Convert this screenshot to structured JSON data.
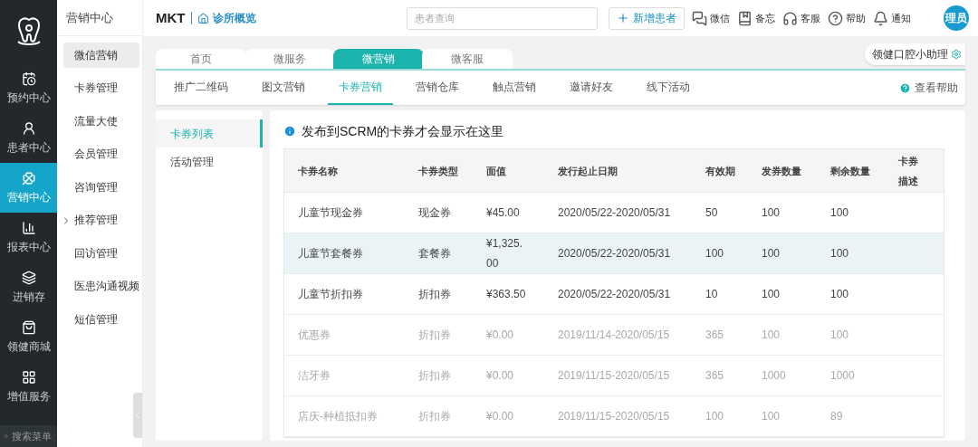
{
  "rail": {
    "items": [
      {
        "label": "预约中心",
        "selected": false
      },
      {
        "label": "患者中心",
        "selected": false
      },
      {
        "label": "营销中心",
        "selected": true
      },
      {
        "label": "报表中心",
        "selected": false
      },
      {
        "label": "进销存",
        "selected": false
      },
      {
        "label": "领健商城",
        "selected": false
      },
      {
        "label": "增值服务",
        "selected": false
      }
    ],
    "search": {
      "placeholder": "搜索菜单"
    }
  },
  "sidebar": {
    "title": "营销中心",
    "items": [
      {
        "label": "微信营销",
        "selected": true,
        "expandable": false
      },
      {
        "label": "卡券管理",
        "selected": false,
        "expandable": false
      },
      {
        "label": "流量大使",
        "selected": false,
        "expandable": false
      },
      {
        "label": "会员管理",
        "selected": false,
        "expandable": false
      },
      {
        "label": "咨询管理",
        "selected": false,
        "expandable": false
      },
      {
        "label": "推荐管理",
        "selected": false,
        "expandable": true
      },
      {
        "label": "回访管理",
        "selected": false,
        "expandable": false
      },
      {
        "label": "医患沟通视频",
        "selected": false,
        "expandable": false
      },
      {
        "label": "短信管理",
        "selected": false,
        "expandable": false
      }
    ]
  },
  "header": {
    "title": "MKT",
    "link": "诊所概览",
    "search": {
      "placeholder": "患者查询"
    },
    "add_button": "新增患者",
    "actions": [
      {
        "label": "微信"
      },
      {
        "label": "备忘"
      },
      {
        "label": "客服"
      },
      {
        "label": "帮助"
      },
      {
        "label": "通知"
      }
    ],
    "avatar": "理员"
  },
  "tabs": [
    {
      "label": "首页",
      "selected": false
    },
    {
      "label": "微服务",
      "selected": false
    },
    {
      "label": "微营销",
      "selected": true
    },
    {
      "label": "微客服",
      "selected": false
    }
  ],
  "assistant": "领健口腔小助理",
  "subtabs": [
    {
      "label": "推广二维码",
      "selected": false
    },
    {
      "label": "图文营销",
      "selected": false
    },
    {
      "label": "卡券营销",
      "selected": true
    },
    {
      "label": "营销仓库",
      "selected": false
    },
    {
      "label": "触点营销",
      "selected": false
    },
    {
      "label": "邀请好友",
      "selected": false
    },
    {
      "label": "线下活动",
      "selected": false
    }
  ],
  "help_link": "查看帮助",
  "side_menu": [
    {
      "label": "卡券列表",
      "selected": true
    },
    {
      "label": "活动管理",
      "selected": false
    }
  ],
  "notice": "发布到SCRM的卡券才会显示在这里",
  "table": {
    "columns": [
      "卡券名称",
      "卡券类型",
      "面值",
      "发行起止日期",
      "有效期",
      "发券数量",
      "剩余数量",
      "卡券描述"
    ],
    "rows": [
      {
        "cells": [
          "儿童节现金券",
          "现金券",
          "¥45.00",
          "2020/05/22-2020/05/31",
          "50",
          "100",
          "100"
        ],
        "selected": false,
        "disabled": false
      },
      {
        "cells": [
          "儿童节套餐券",
          "套餐券",
          "¥1,325.00",
          "2020/05/22-2020/05/31",
          "100",
          "100",
          "100"
        ],
        "selected": true,
        "disabled": false
      },
      {
        "cells": [
          "儿童节折扣券",
          "折扣券",
          "¥363.50",
          "2020/05/22-2020/05/31",
          "10",
          "100",
          "100"
        ],
        "selected": false,
        "disabled": false
      },
      {
        "cells": [
          "优惠券",
          "折扣券",
          "¥0.00",
          "2019/11/14-2020/05/15",
          "365",
          "100",
          "100"
        ],
        "selected": false,
        "disabled": true
      },
      {
        "cells": [
          "洁牙券",
          "折扣券",
          "¥0.00",
          "2019/11/15-2020/05/15",
          "365",
          "1000",
          "1000"
        ],
        "selected": false,
        "disabled": true
      },
      {
        "cells": [
          "店庆-种植抵扣券",
          "折扣券",
          "¥0.00",
          "2019/11/15-2020/05/15",
          "100",
          "100",
          "89"
        ],
        "selected": false,
        "disabled": true
      }
    ]
  }
}
